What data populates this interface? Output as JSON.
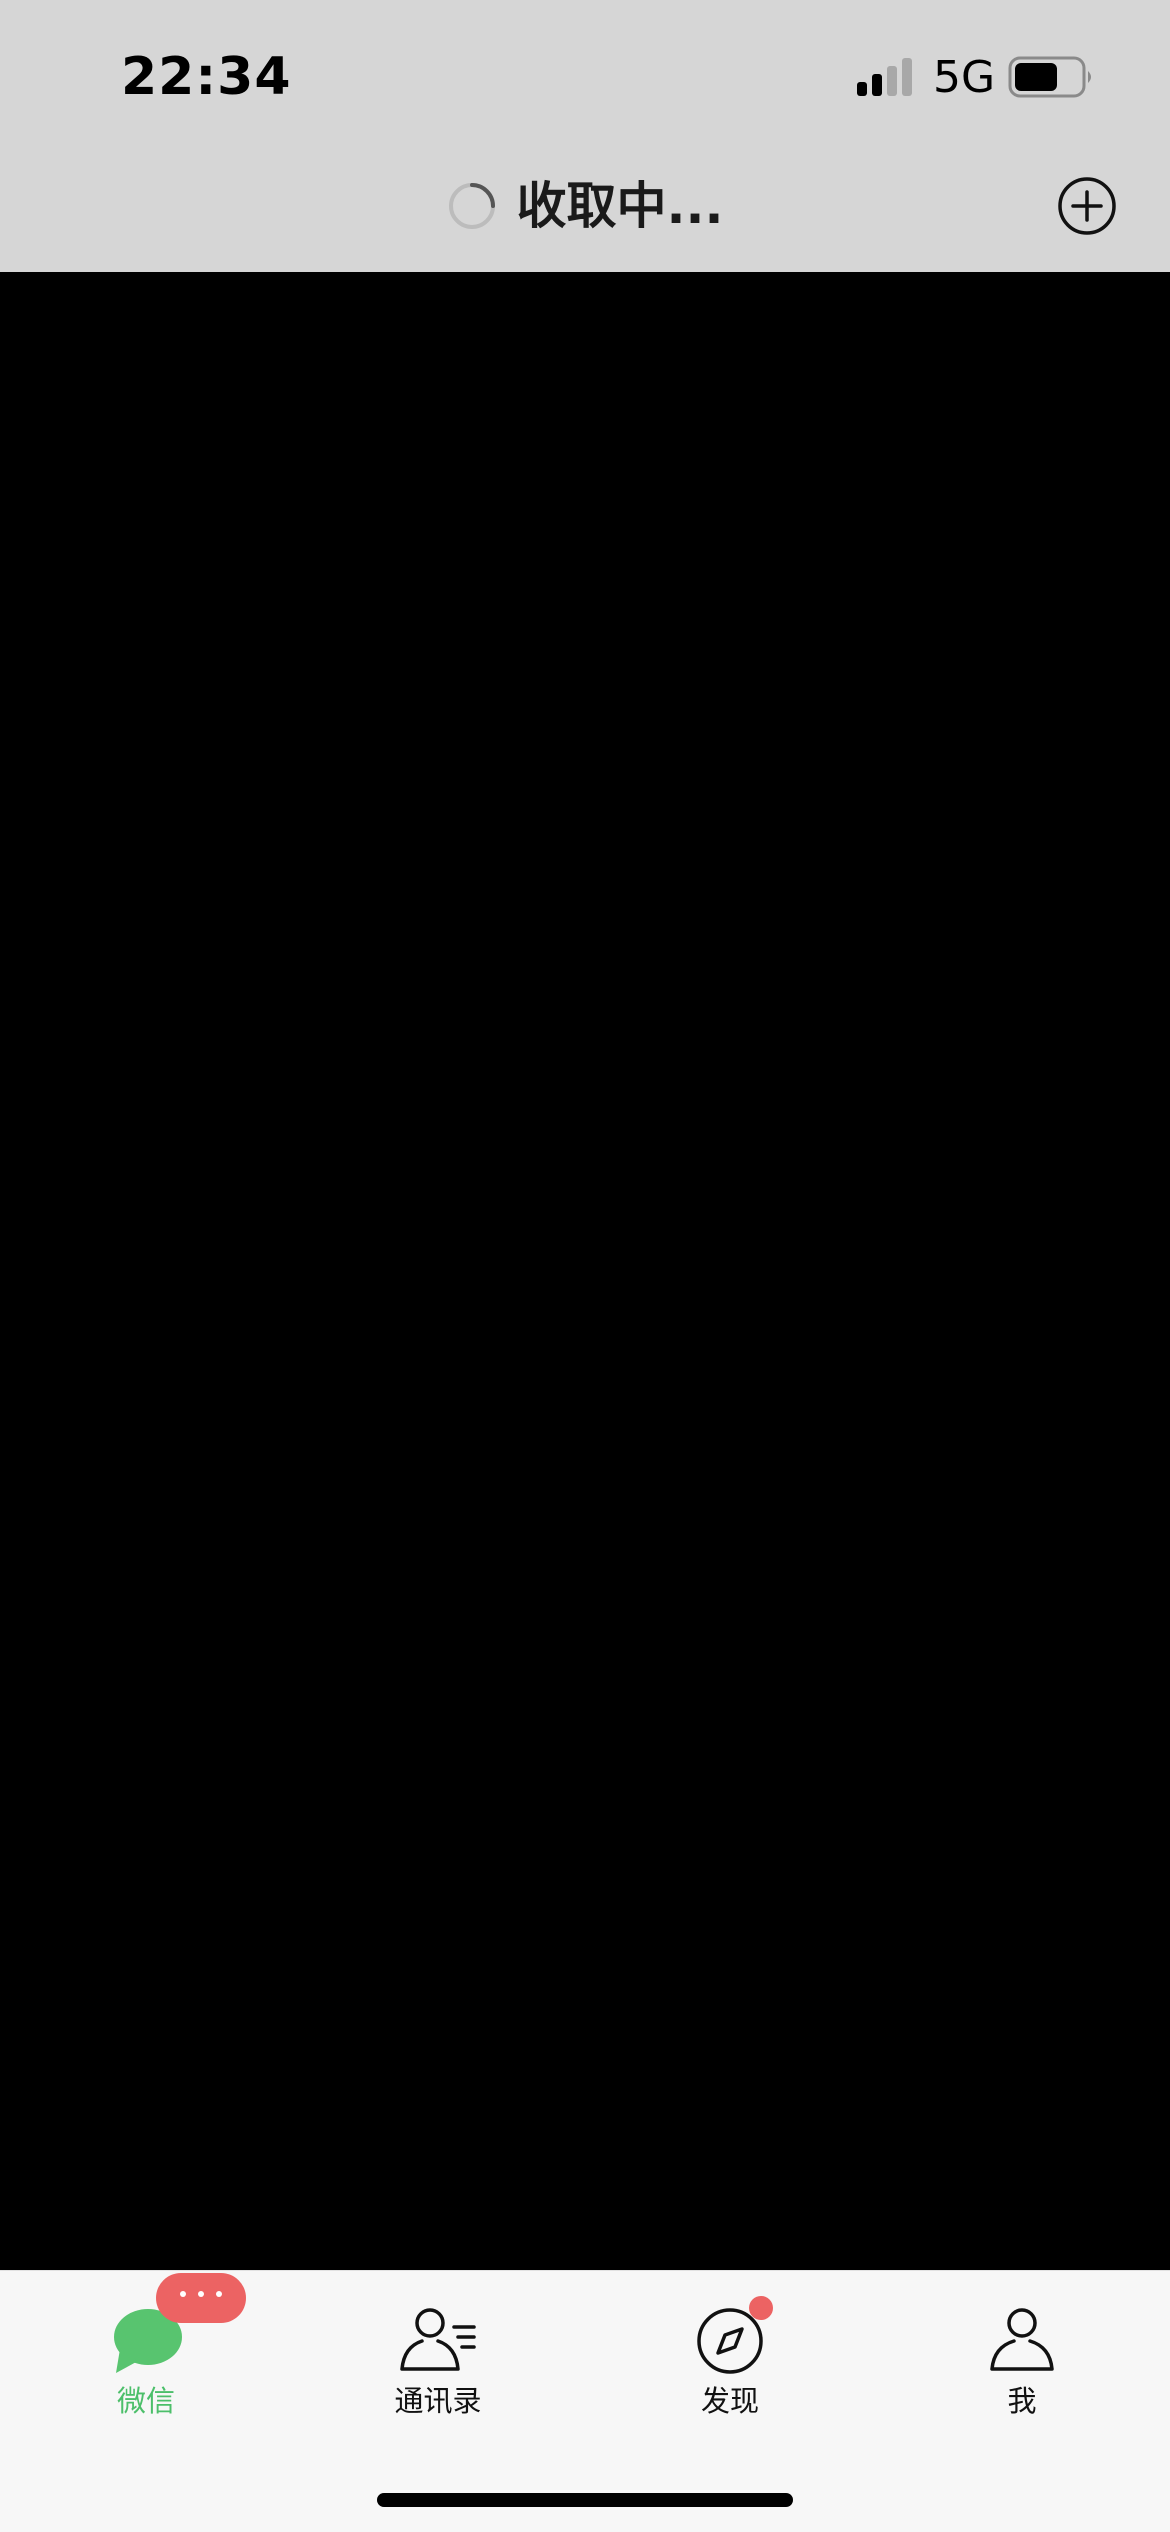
{
  "status_bar": {
    "time": "22:34",
    "network": "5G",
    "signal_bars_active": 2,
    "signal_bars_total": 4,
    "battery_level": 0.6
  },
  "nav": {
    "title": "收取中...",
    "loading_icon": "spinner-icon",
    "action_icon": "add-circle-icon"
  },
  "tabbar": {
    "tabs": [
      {
        "label": "微信",
        "icon": "chat-bubble-icon",
        "active": true
      },
      {
        "label": "通讯录",
        "icon": "contacts-icon",
        "active": false
      },
      {
        "label": "发现",
        "icon": "compass-icon",
        "active": false
      },
      {
        "label": "我",
        "icon": "person-icon",
        "active": false
      }
    ],
    "unread_badge_icon": "ellipsis-badge-icon",
    "discover_dot": true
  },
  "colors": {
    "topbar_bg": "#d6d6d6",
    "content_bg": "#000000",
    "tabbar_bg": "#f7f7f7",
    "active_green": "#4cbf6a",
    "badge_red": "#ec6363"
  }
}
